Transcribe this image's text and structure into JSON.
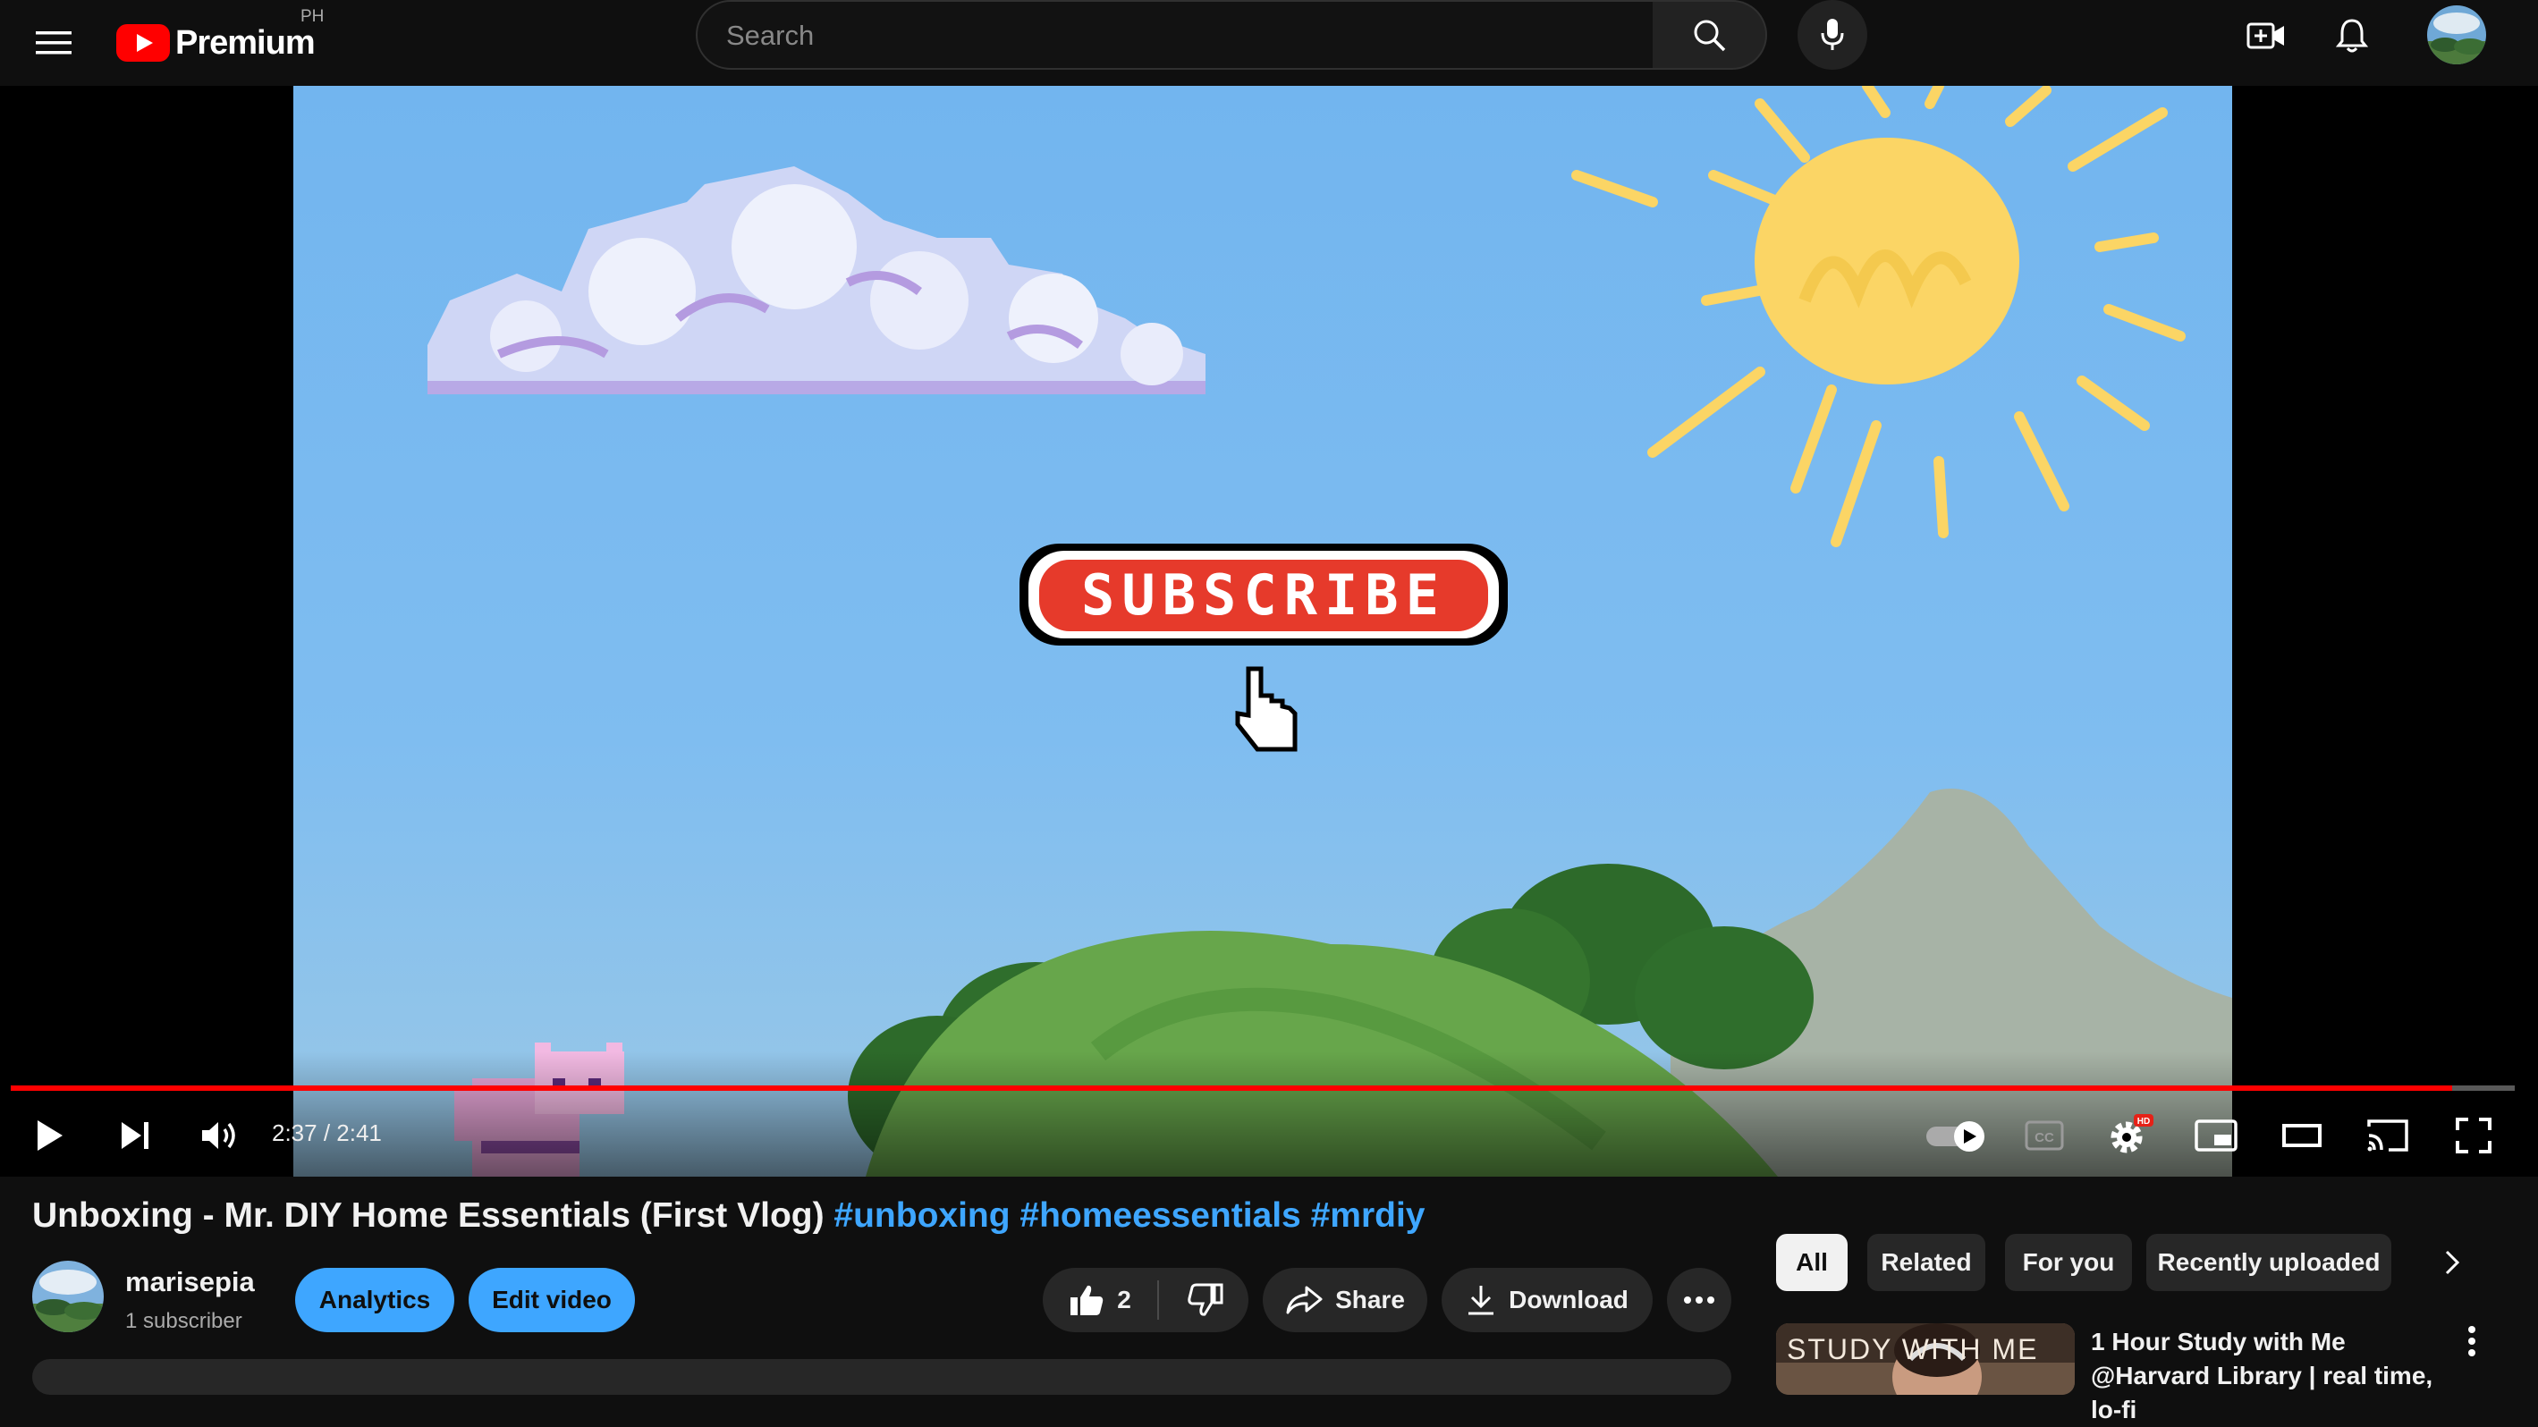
{
  "header": {
    "logo_text": "Premium",
    "region": "PH",
    "search_placeholder": "Search"
  },
  "video_frame": {
    "subscribe_text": "SUBSCRIBE"
  },
  "player": {
    "time_current": "2:37",
    "time_total": "2:41",
    "time_display": "2:37 / 2:41",
    "progress_fraction": 0.975,
    "autoplay": "on",
    "settings_badge": "HD"
  },
  "video": {
    "title_main": "Unboxing - Mr. DIY Home Essentials (First Vlog)",
    "hashtags": [
      "#unboxing",
      "#homeessentials",
      "#mrdiy"
    ]
  },
  "channel": {
    "name": "marisepia",
    "subscribers": "1 subscriber"
  },
  "actions": {
    "analytics": "Analytics",
    "edit_video": "Edit video",
    "like_count": "2",
    "share": "Share",
    "download": "Download"
  },
  "chips": [
    "All",
    "Related",
    "For you",
    "Recently uploaded"
  ],
  "recommendation": {
    "title": "1 Hour Study with Me @Harvard Library | real time, lo-fi",
    "thumb_text": "STUDY WITH ME"
  },
  "colors": {
    "accent_red": "#ff0000",
    "link_blue": "#3ea6ff",
    "sky": "#72b5ef",
    "sun": "#fbd565"
  }
}
